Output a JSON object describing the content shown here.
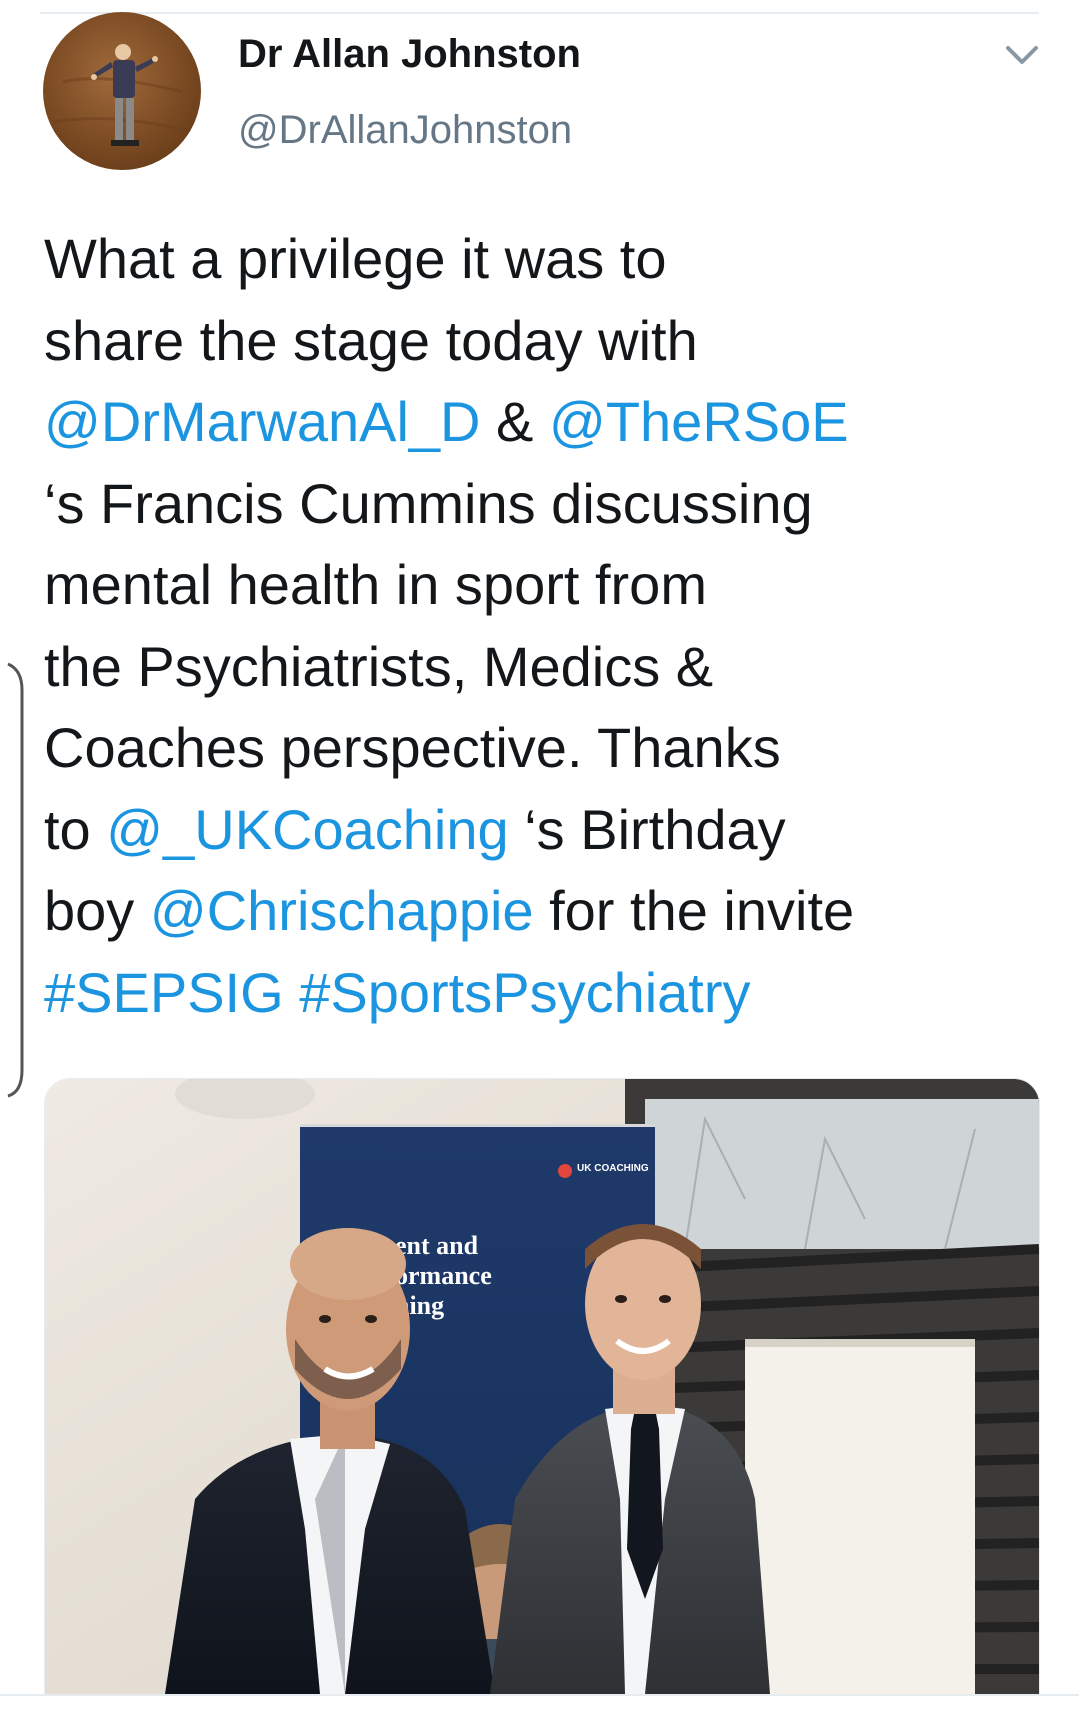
{
  "tweet": {
    "author": {
      "display_name": "Dr Allan Johnston",
      "handle": "@DrAllanJohnston"
    },
    "menu_icon": "chevron-down-icon",
    "text_lines": [
      [
        {
          "t": "What a privilege it was to",
          "link": false
        }
      ],
      [
        {
          "t": "share the stage today with",
          "link": false
        }
      ],
      [
        {
          "t": "@DrMarwanAl_D",
          "link": true
        },
        {
          "t": " & ",
          "link": false
        },
        {
          "t": "@TheRSoE",
          "link": true
        }
      ],
      [
        {
          "t": "‘s Francis Cummins discussing",
          "link": false
        }
      ],
      [
        {
          "t": "mental health in sport from",
          "link": false
        }
      ],
      [
        {
          "t": "the Psychiatrists, Medics &",
          "link": false
        }
      ],
      [
        {
          "t": "Coaches perspective. Thanks",
          "link": false
        }
      ],
      [
        {
          "t": "to ",
          "link": false
        },
        {
          "t": "@_UKCoaching",
          "link": true
        },
        {
          "t": " ‘s Birthday",
          "link": false
        }
      ],
      [
        {
          "t": "boy ",
          "link": false
        },
        {
          "t": "@Chrischappie",
          "link": true
        },
        {
          "t": " for the invite",
          "link": false
        }
      ],
      [
        {
          "t": "#SEPSIG",
          "link": true
        },
        {
          "t": " ",
          "link": false
        },
        {
          "t": "#SportsPsychiatry",
          "link": true
        }
      ]
    ],
    "media": {
      "banner_brand": "UK COACHING",
      "banner_text_lines": [
        "ent and",
        "ormance",
        "hing"
      ]
    }
  },
  "colors": {
    "text": "#14171a",
    "secondary": "#657786",
    "link": "#1b95e0",
    "divider": "#e6ecf0"
  }
}
